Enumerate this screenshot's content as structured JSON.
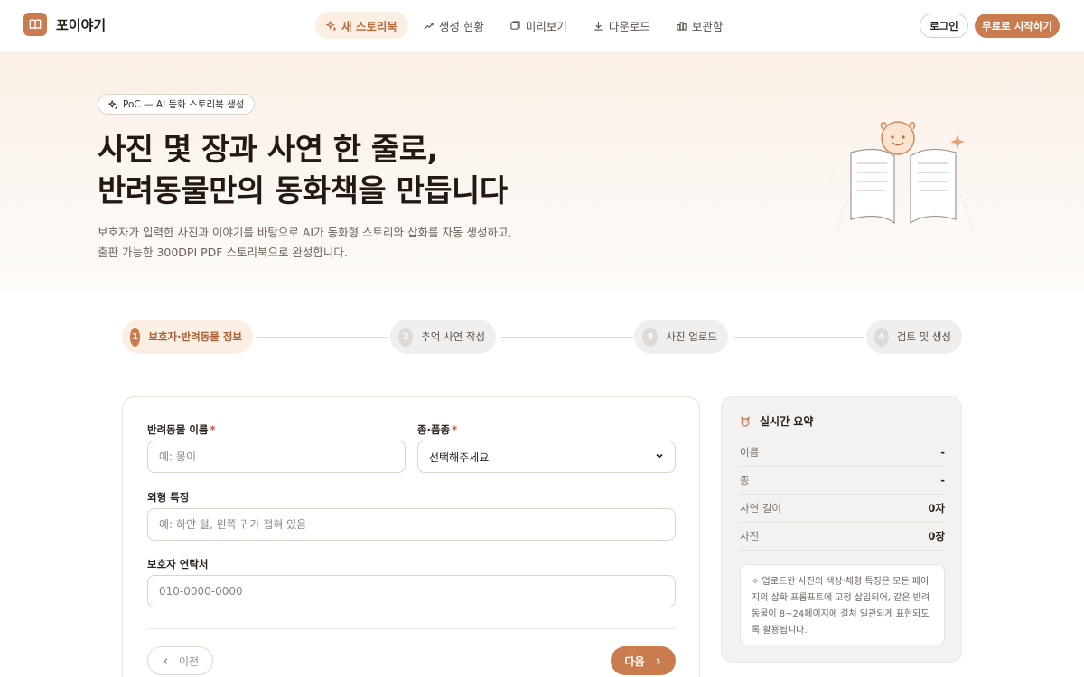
{
  "app": {
    "brand_name": "포이야기",
    "accent_color": "#c97c4d"
  },
  "nav": {
    "items": [
      {
        "label": "새 스토리북",
        "icon": "sparkle-icon",
        "active": true
      },
      {
        "label": "생성 현황",
        "icon": "trend-icon",
        "active": false
      },
      {
        "label": "미리보기",
        "icon": "preview-icon",
        "active": false
      },
      {
        "label": "다운로드",
        "icon": "download-icon",
        "active": false
      },
      {
        "label": "보관함",
        "icon": "archive-icon",
        "active": false
      }
    ],
    "login_label": "로그인",
    "start_label": "무료로 시작하기"
  },
  "hero": {
    "badge": "PoC — AI 동화 스토리북 생성",
    "title_line1": "사진 몇 장과 사연 한 줄로,",
    "title_line2": "반려동물만의 동화책을 만듭니다",
    "desc_line1": "보호자가 입력한 사진과 이야기를 바탕으로 AI가 동화형 스토리와 삽화를 자동 생성하고,",
    "desc_line2": "출판 가능한 300DPI PDF 스토리북으로 완성합니다."
  },
  "stepper": {
    "steps": [
      {
        "num": "1",
        "label": "보호자·반려동물 정보",
        "active": true
      },
      {
        "num": "2",
        "label": "추억 사연 작성",
        "active": false
      },
      {
        "num": "3",
        "label": "사진 업로드",
        "active": false
      },
      {
        "num": "4",
        "label": "검토 및 생성",
        "active": false
      }
    ]
  },
  "form": {
    "pet_name": {
      "label": "반려동물 이름",
      "required_mark": "*",
      "placeholder": "예: 몽이"
    },
    "species": {
      "label": "종·품종",
      "required_mark": "*",
      "selected": "선택해주세요"
    },
    "appearance": {
      "label": "외형 특징",
      "placeholder": "예: 하얀 털, 왼쪽 귀가 접혀 있음"
    },
    "contact": {
      "label": "보호자 연락처",
      "placeholder": "010-0000-0000"
    },
    "prev_label": "이전",
    "next_label": "다음"
  },
  "summary": {
    "title": "실시간 요약",
    "rows": [
      {
        "key": "이름",
        "value": "-"
      },
      {
        "key": "종",
        "value": "-"
      },
      {
        "key": "사연 길이",
        "value": "0자"
      },
      {
        "key": "사진",
        "value": "0장"
      }
    ],
    "note": "✧ 업로드한 사진의 색상·체형 특징은 모든 페이지의 삽화 프롬프트에 고정 삽입되어, 같은 반려동물이 8~24페이지에 걸쳐 일관되게 표현되도록 활용됩니다."
  }
}
